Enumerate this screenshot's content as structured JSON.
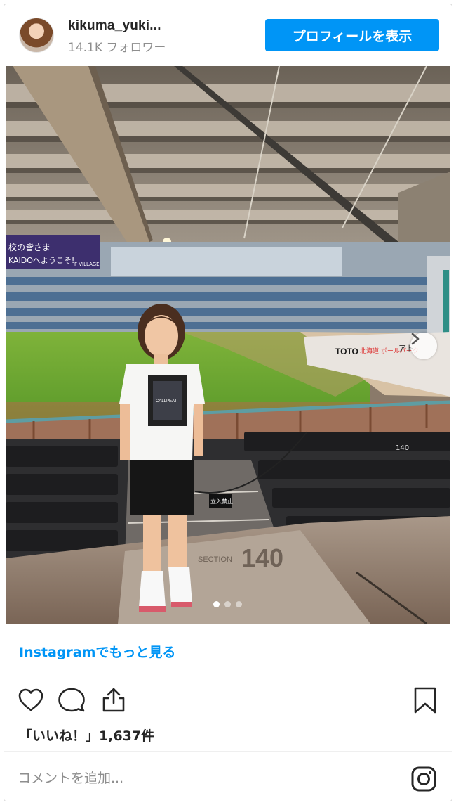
{
  "header": {
    "username": "kikuma_yuki...",
    "followers": "14.1K フォロワー",
    "profile_button": "プロフィールを表示"
  },
  "photo": {
    "banner_text": "校の皆さま",
    "banner_text2": "KAIDOへようこそ!",
    "banner_brand": "F VILLAGE",
    "wall_sponsor1": "TOTO",
    "wall_sponsor2": "北海道 ボールパーク",
    "wall_sponsor3": "アト",
    "shirt_text": "CALLPEAT",
    "sign_text": "立入禁止",
    "section_label": "SECTION",
    "section_number": "140",
    "seat_number": "140",
    "page_dots": {
      "current": 1,
      "total": 3
    }
  },
  "links": {
    "more_on_instagram": "Instagramでもっと見る"
  },
  "actions": {
    "like_icon": "heart-icon",
    "comment_icon": "comment-icon",
    "share_icon": "share-icon",
    "save_icon": "bookmark-icon"
  },
  "likes": {
    "text": "「いいね！」1,637件"
  },
  "comment": {
    "placeholder": "コメントを追加..."
  },
  "colors": {
    "accent": "#0095f6",
    "text": "#262626",
    "muted": "#8e8e8e"
  }
}
